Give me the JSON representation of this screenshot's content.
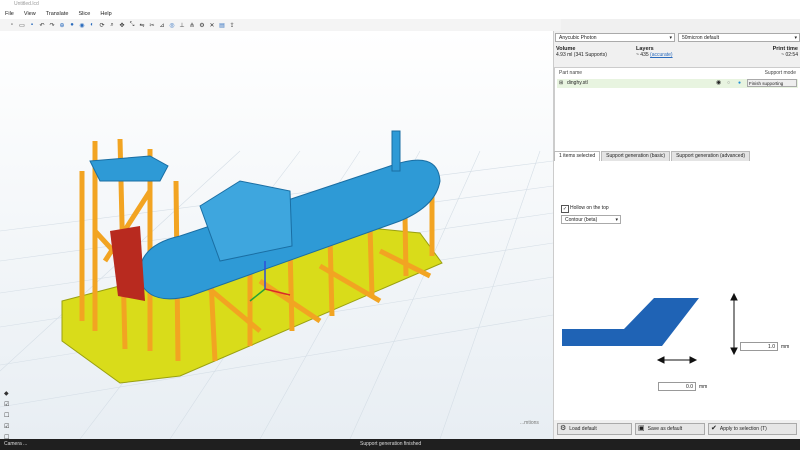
{
  "window": {
    "title": "Untitled.lcd"
  },
  "menu": [
    "File",
    "View",
    "Translate",
    "Slice",
    "Help"
  ],
  "toolbar_icons": [
    "new-icon",
    "open-icon",
    "save-icon",
    "undo-icon",
    "redo-icon",
    "support-icon",
    "view-front-icon",
    "view-top-icon",
    "view-side-icon",
    "rotate-icon",
    "zoom-icon",
    "move-icon",
    "scale-icon",
    "mirror-icon",
    "cut-icon",
    "measure-icon",
    "hollow-icon",
    "drill-icon",
    "auto-support-icon",
    "settings-icon",
    "delete-icon",
    "slice-icon",
    "export-icon"
  ],
  "printer": {
    "machine": "Anycubic Photon",
    "profile": "50micron default"
  },
  "stats": {
    "volume_label": "Volume",
    "volume_value": "4.93 ml (341 Supports)",
    "layers_label": "Layers",
    "layers_value": "~ 435",
    "layers_link": "(accurate)",
    "time_label": "Print time",
    "time_value": "~ 02:54"
  },
  "parts": {
    "header_name": "Part name",
    "header_mode": "Support mode",
    "rows": [
      {
        "name": "dinghy.stl",
        "mode": "Finish supporting"
      }
    ]
  },
  "tabs": [
    "1 items selected",
    "Support generation (basic)",
    "Support generation (advanced)"
  ],
  "hollow": {
    "label": "Hollow on the top",
    "checked": true
  },
  "infill": {
    "value": "Contour (beta)"
  },
  "dims": {
    "height": "1.0",
    "width": "0.0",
    "unit": "mm"
  },
  "buttons": {
    "load": "Load default",
    "save": "Save as default",
    "apply": "Apply to selection (T)"
  },
  "viewport": {
    "watermark": "...mtions"
  },
  "status": {
    "camera": "Camera ...",
    "message": "Support generation finished"
  }
}
